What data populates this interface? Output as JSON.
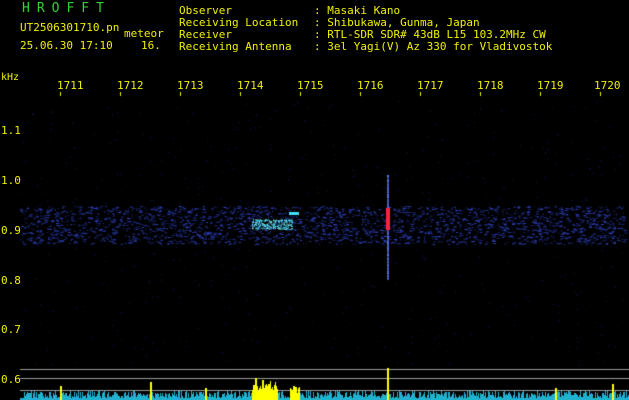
{
  "header": {
    "app_title": "HROFFT",
    "filename": "UT2506301710.pn",
    "filename_suffix": "meteor",
    "datetime": "25.06.30 17:10",
    "sequence": "16."
  },
  "info": [
    {
      "label": "Observer",
      "value": ": Masaki Kano"
    },
    {
      "label": "Receiving Location",
      "value": ": Shibukawa, Gunma, Japan"
    },
    {
      "label": "Receiver",
      "value": ": RTL-SDR SDR# 43dB L15 103.2MHz CW"
    },
    {
      "label": "Receiving Antenna",
      "value": ": 3el Yagi(V) Az 330 for Vladivostok"
    }
  ],
  "axes": {
    "unit": "kHz",
    "x_ticks": [
      "1711",
      "1712",
      "1713",
      "1714",
      "1715",
      "1716",
      "1717",
      "1718",
      "1719",
      "1720"
    ],
    "y_ticks": [
      "1.1",
      "1.0",
      "0.9",
      "0.8",
      "0.7",
      "0.6"
    ]
  },
  "colors": {
    "text_green": "#32d232",
    "text_yellow": "#f0f000",
    "background": "#000000",
    "noise_band": "#2a3aa0",
    "echo_red": "#ff2040",
    "echo_cyan": "#40e0ff",
    "spectrum_cyan": "#20b0d0",
    "spectrum_yellow": "#ffff00"
  }
}
